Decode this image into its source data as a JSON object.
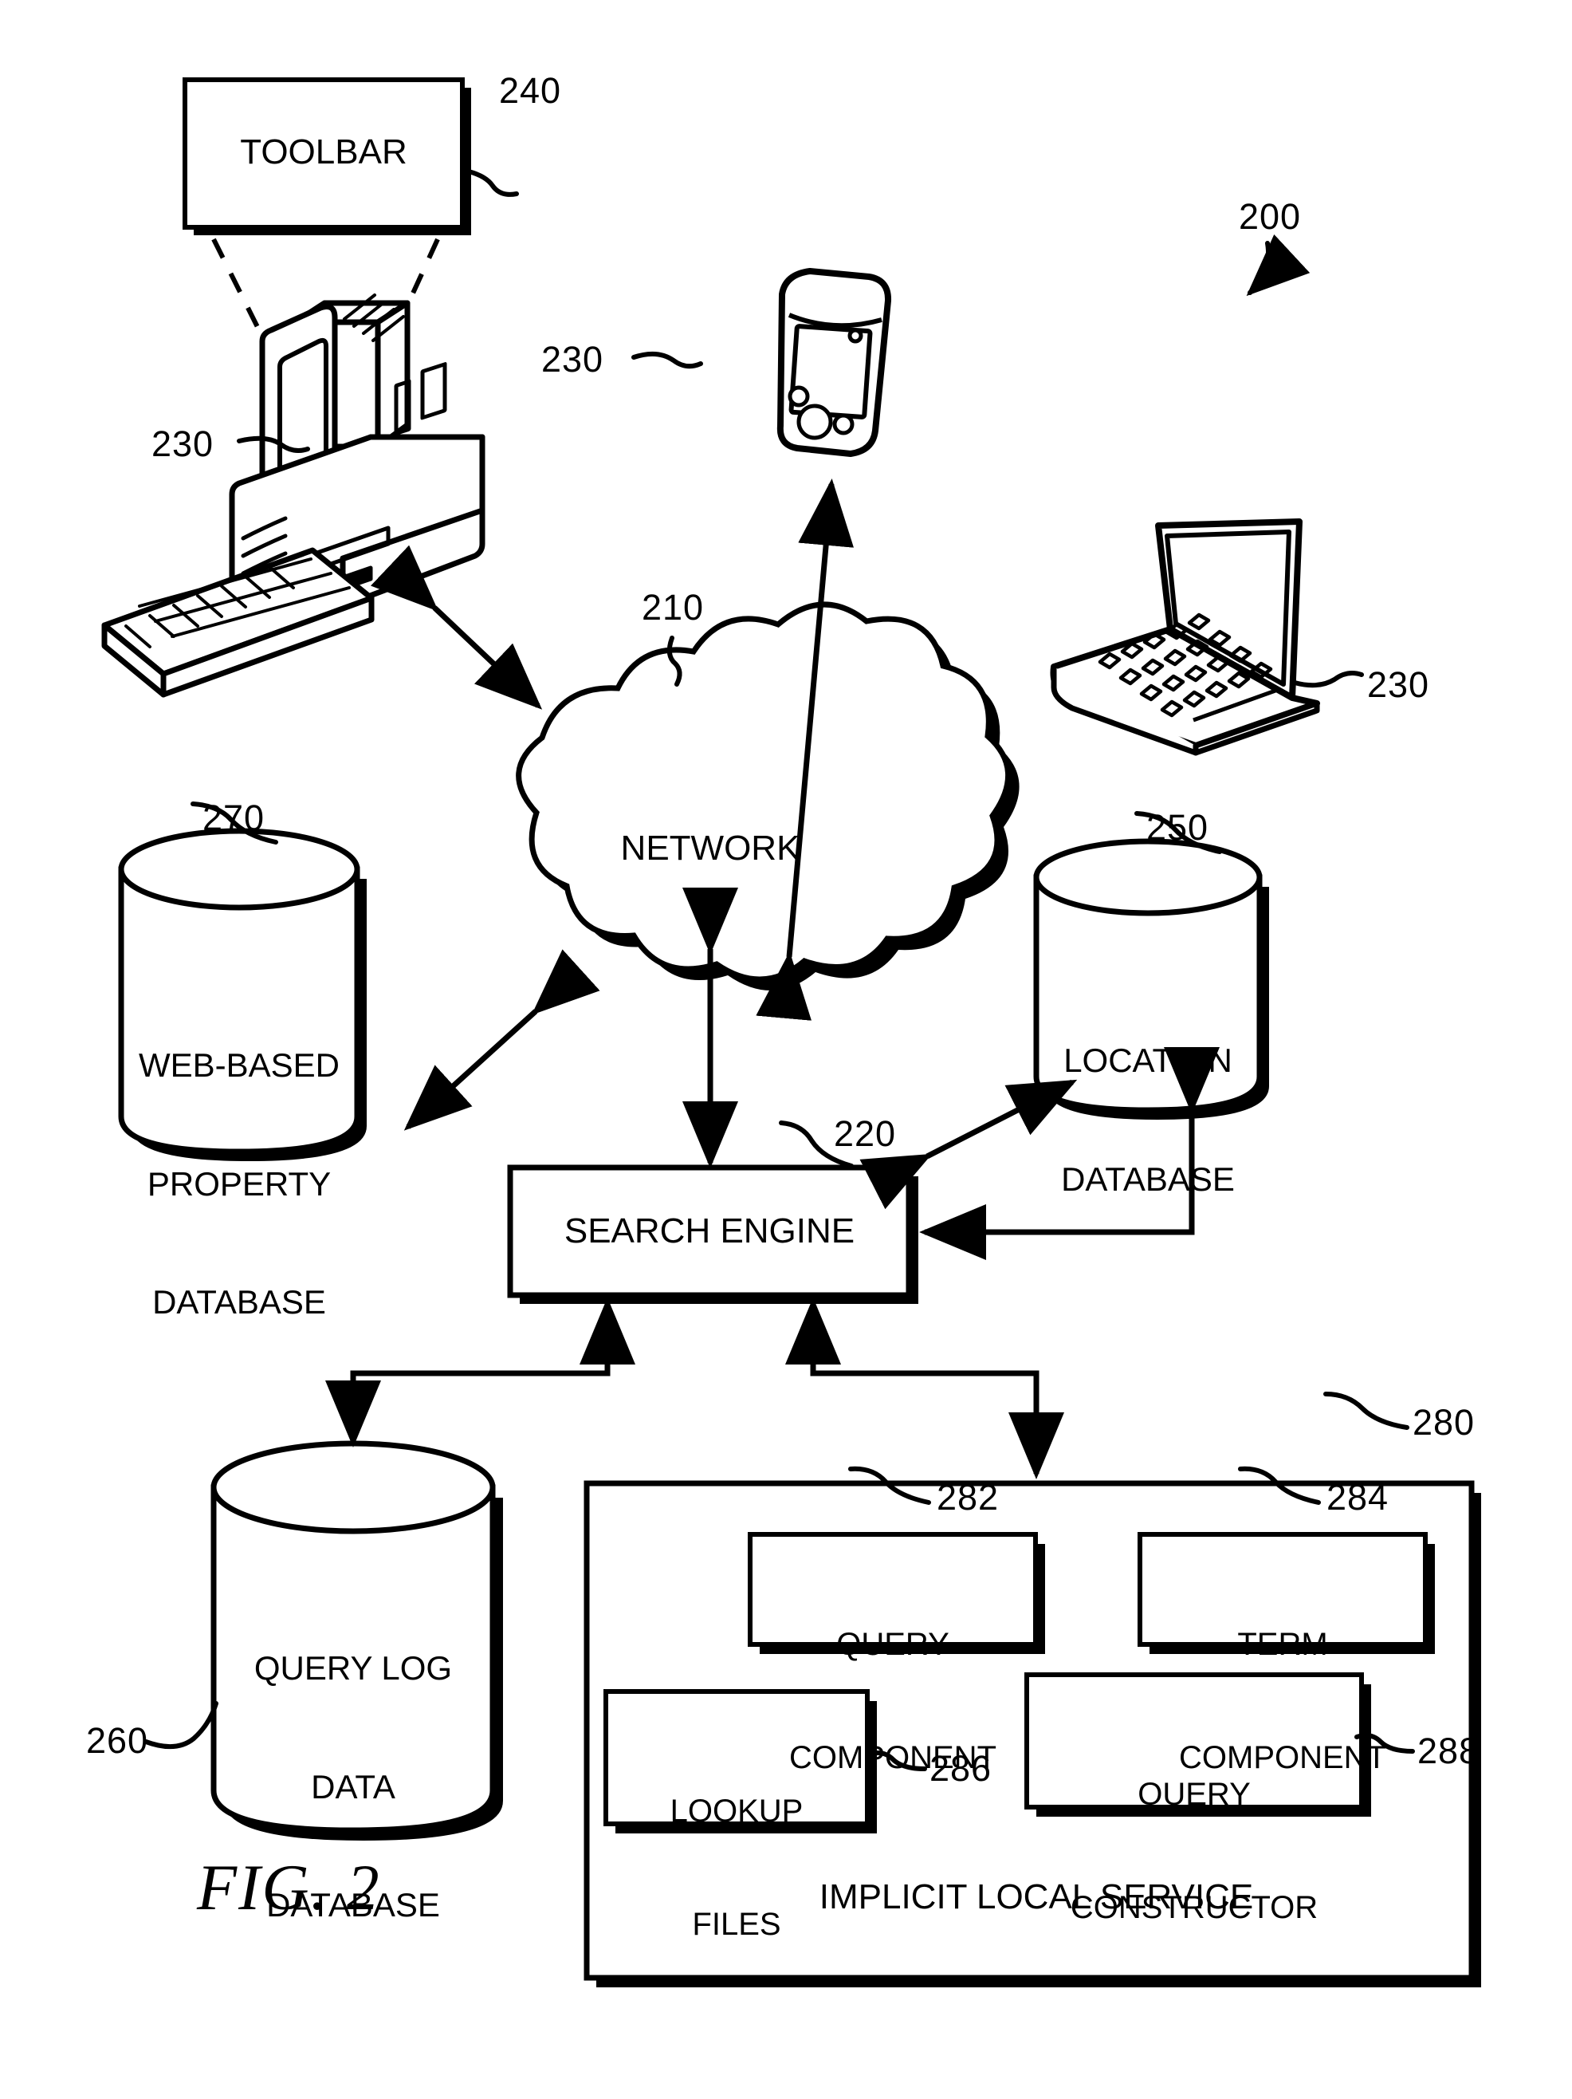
{
  "figure": {
    "caption": "FIG. 2",
    "system_ref": "200"
  },
  "nodes": {
    "toolbar": {
      "label": "TOOLBAR",
      "ref": "240"
    },
    "desktop_computer": {
      "ref": "230",
      "icon": "desktop-computer-icon"
    },
    "pda": {
      "ref": "230",
      "icon": "pda-handheld-icon"
    },
    "laptop": {
      "ref": "230",
      "icon": "laptop-computer-icon"
    },
    "network": {
      "label": "NETWORK",
      "ref": "210"
    },
    "web_property_db": {
      "label": "WEB-BASED\nPROPERTY\nDATABASE",
      "line1": "WEB-BASED",
      "line2": "PROPERTY",
      "line3": "DATABASE",
      "ref": "270"
    },
    "location_db": {
      "label": "LOCATION\nDATABASE",
      "line1": "LOCATION",
      "line2": "DATABASE",
      "ref": "250"
    },
    "search_engine": {
      "label": "SEARCH ENGINE",
      "ref": "220"
    },
    "query_log_db": {
      "line1": "QUERY LOG",
      "line2": "DATA",
      "line3": "DATABASE",
      "ref": "260"
    },
    "implicit_local_service": {
      "label": "IMPLICIT LOCAL SERVICE",
      "ref": "280"
    },
    "query_component": {
      "line1": "QUERY",
      "line2": "COMPONENT",
      "ref": "282"
    },
    "term_component": {
      "line1": "TERM",
      "line2": "COMPONENT",
      "ref": "284"
    },
    "lookup_files": {
      "line1": "LOOKUP",
      "line2": "FILES",
      "ref": "286"
    },
    "query_constructor": {
      "line1": "QUERY",
      "line2": "CONSTRUCTOR",
      "ref": "288"
    }
  },
  "colors": {
    "ink": "#000000",
    "paper": "#ffffff"
  }
}
